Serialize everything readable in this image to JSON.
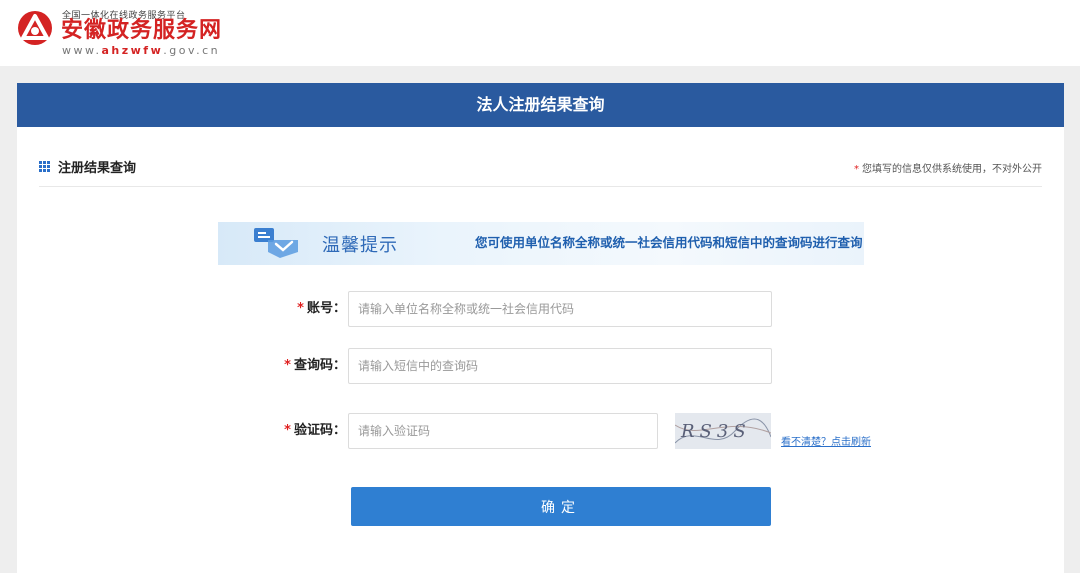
{
  "header": {
    "platform_subtitle": "全国一体化在线政务服务平台",
    "site_name": "安徽政务服务网",
    "url_prefix": "www.",
    "url_domain": "ahzwfw",
    "url_suffix": ".gov.cn",
    "brand_color": "#d42323"
  },
  "panel": {
    "title": "法人注册结果查询",
    "header_color": "#2a5a9f"
  },
  "section": {
    "title": "注册结果查询",
    "privacy_star": "*",
    "privacy_note": "您填写的信息仅供系统使用，不对外公开"
  },
  "tip": {
    "title": "温馨提示",
    "text": "您可使用单位名称全称或统一社会信用代码和短信中的查询码进行查询"
  },
  "form": {
    "required_mark": "*",
    "account": {
      "label": "账号：",
      "value": "",
      "placeholder": "请输入单位名称全称或统一社会信用代码"
    },
    "query_code": {
      "label": "查询码：",
      "value": "",
      "placeholder": "请输入短信中的查询码"
    },
    "captcha": {
      "label": "验证码：",
      "value": "",
      "placeholder": "请输入验证码",
      "image_text": "RS3S",
      "refresh_link": "看不清楚？点击刷新"
    },
    "submit_label": "确定",
    "accent_color": "#2f7fd2",
    "required_color": "#e02020"
  }
}
